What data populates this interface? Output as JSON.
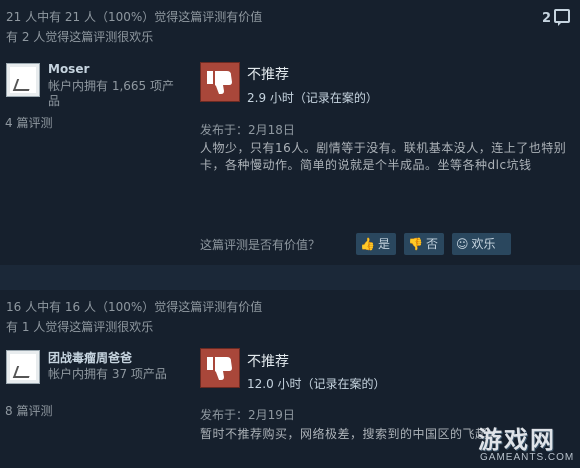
{
  "reviews": [
    {
      "helpful_text": "21 人中有 21 人（100%）觉得这篇评测有价值",
      "funny_text": "有 2 人觉得这篇评测很欢乐",
      "comment_count": "2",
      "username": "Moser",
      "user_stats": "帐户内拥有 1,665 项产品",
      "user_reviews": "4 篇评测",
      "recommendation": "不推荐",
      "hours": "2.9 小时（记录在案的）",
      "posted": "发布于：2月18日",
      "content": "人物少，只有16人。剧情等于没有。联机基本没人，连上了也特别卡，各种慢动作。简单的说就是个半成品。坐等各种dlc坑钱",
      "helpful_question": "这篇评测是否有价值？",
      "buttons": {
        "yes": "是",
        "no": "否",
        "funny": "欢乐"
      }
    },
    {
      "helpful_text": "16 人中有 16 人（100%）觉得这篇评测有价值",
      "funny_text": "有 1 人觉得这篇评测很欢乐",
      "username": "团战毒瘤周爸爸",
      "user_stats": "帐户内拥有 37 项产品",
      "user_reviews": "8 篇评测",
      "recommendation": "不推荐",
      "hours": "12.0 小时（记录在案的）",
      "posted": "发布于：2月19日",
      "content": "暂时不推荐购买，网络极差，搜索到的中国区的飞起。"
    }
  ],
  "watermark": {
    "main": "游戏网",
    "sub": "GAMEANTS.COM"
  },
  "colors": {
    "background": "#1b2838",
    "panel": "#16202d",
    "thumb_down": "#a9473a",
    "vote_button": "#2a475e"
  }
}
